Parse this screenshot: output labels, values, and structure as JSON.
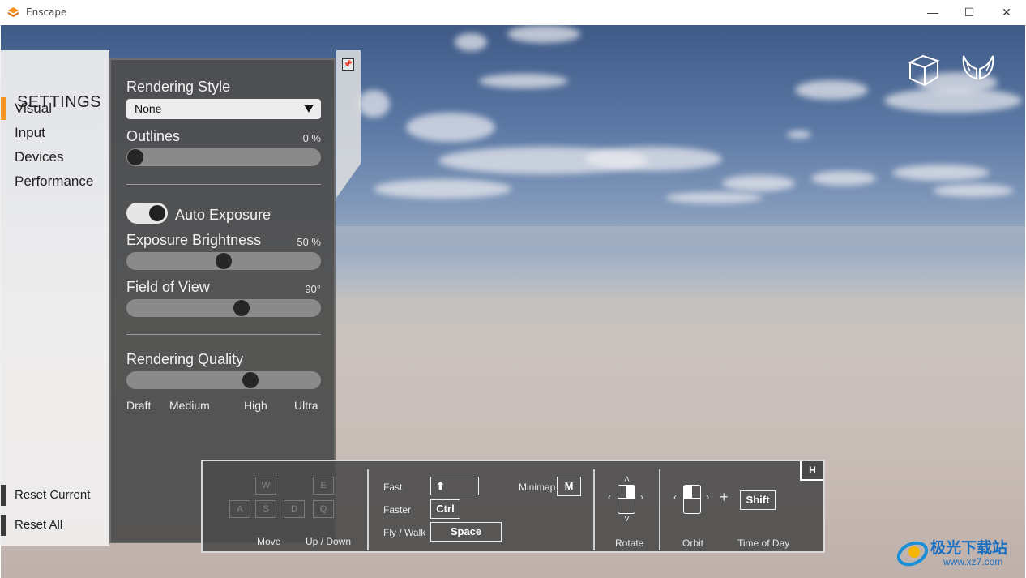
{
  "window": {
    "title": "Enscape",
    "controls": {
      "minimize": "—",
      "maximize": "☐",
      "close": "✕"
    }
  },
  "settings": {
    "heading": "SETTINGS",
    "nav": [
      {
        "label": "Visual",
        "active": true
      },
      {
        "label": "Input",
        "active": false
      },
      {
        "label": "Devices",
        "active": false
      },
      {
        "label": "Performance",
        "active": false
      }
    ],
    "reset_current": "Reset Current",
    "reset_all": "Reset All"
  },
  "visual": {
    "rendering_style": {
      "label": "Rendering Style",
      "value": "None"
    },
    "outlines": {
      "label": "Outlines",
      "value_text": "0 %",
      "value": 0
    },
    "auto_exposure": {
      "label": "Auto Exposure",
      "on": true
    },
    "exposure_brightness": {
      "label": "Exposure Brightness",
      "value_text": "50 %",
      "value": 0.5
    },
    "field_of_view": {
      "label": "Field of View",
      "value_text": "90°",
      "value": 0.6
    },
    "rendering_quality": {
      "label": "Rendering Quality",
      "value": 0.65,
      "levels": [
        "Draft",
        "Medium",
        "High",
        "Ultra"
      ]
    }
  },
  "hud": {
    "toggle_key": "H",
    "move_keys": {
      "w": "W",
      "a": "A",
      "s": "S",
      "d": "D",
      "e": "E",
      "q": "Q"
    },
    "move_label": "Move",
    "updown_label": "Up / Down",
    "fast_label": "Fast",
    "fast_key": "⬆",
    "faster_label": "Faster",
    "faster_key": "Ctrl",
    "flywalk_label": "Fly /  Walk",
    "flywalk_key": "Space",
    "minimap_label": "Minimap",
    "minimap_key": "M",
    "rotate_label": "Rotate",
    "orbit_label": "Orbit",
    "plus": "+",
    "timeofday_key": "Shift",
    "timeofday_label": "Time of Day"
  },
  "watermark": {
    "brand": "极光下载站",
    "url": "www.xz7.com"
  },
  "colors": {
    "accent": "#f7931e",
    "panel_dark": "#4e4e4e",
    "panel_light": "#f0efef"
  },
  "icons": [
    "enscape-logo-icon",
    "pin-icon",
    "cube-view-icon",
    "fly-mode-wings-icon",
    "dropdown-arrow-icon",
    "mouse-icon"
  ]
}
